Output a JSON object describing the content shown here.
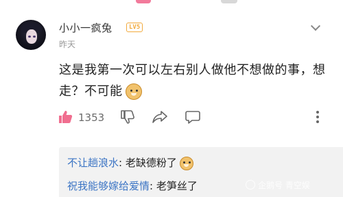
{
  "comment": {
    "username": "小小一疯兔",
    "level_badge": "LV5",
    "time": "昨天",
    "text": "这是我第一次可以左右别人做他不想做的事，想走？不可能",
    "emoji_icon": "doge-icon",
    "likes": "1353"
  },
  "replies": [
    {
      "author": "不让趟浪水",
      "separator": ": ",
      "text": "老缺德粉了",
      "emoji_icon": "doge-icon"
    },
    {
      "author": "祝我能够嫁给爱情",
      "separator": ": ",
      "text": "老笋丝了"
    }
  ],
  "watermark": {
    "text": "企鹅号 青空娱"
  },
  "colors": {
    "accent_blue": "#3b74c4",
    "like_pink": "#f06e8f",
    "badge_orange": "#f2a93b"
  }
}
